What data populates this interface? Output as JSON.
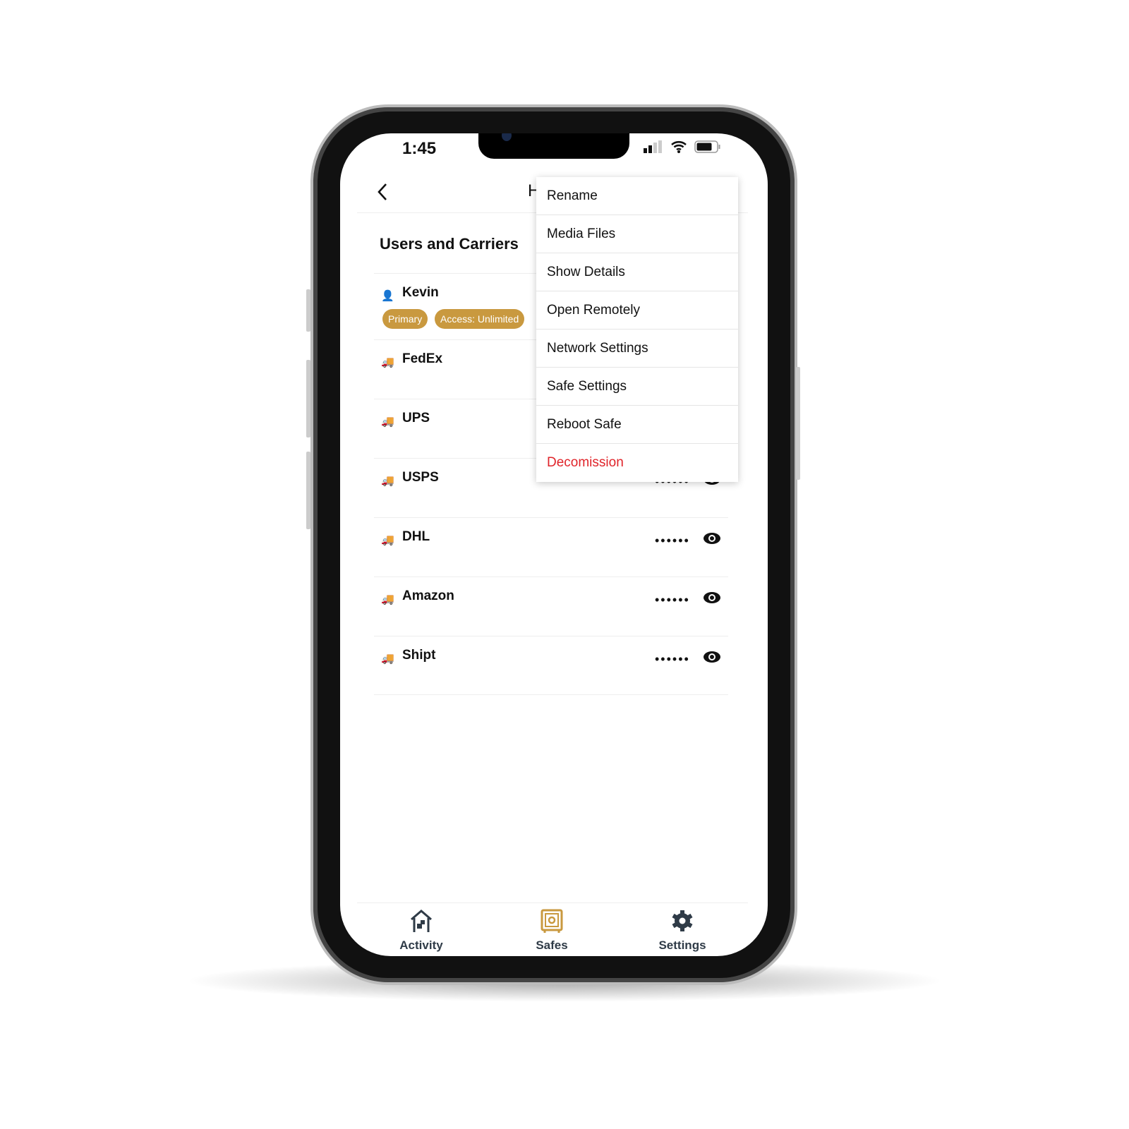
{
  "status_bar": {
    "time": "1:45"
  },
  "header": {
    "title": "H",
    "back_icon": "chevron-left-icon"
  },
  "section_title": "Users and Carriers",
  "user": {
    "name": "Kevin",
    "badges": [
      "Primary",
      "Access: Unlimited"
    ]
  },
  "carriers": [
    {
      "name": "FedEx",
      "code": "••••••"
    },
    {
      "name": "UPS",
      "code": "••••••"
    },
    {
      "name": "USPS",
      "code": "••••••"
    },
    {
      "name": "DHL",
      "code": "••••••"
    },
    {
      "name": "Amazon",
      "code": "••••••"
    },
    {
      "name": "Shipt",
      "code": "••••••"
    }
  ],
  "menu": [
    "Rename",
    "Media Files",
    "Show Details",
    "Open Remotely",
    "Network Settings",
    "Safe Settings",
    "Reboot Safe",
    "Decomission"
  ],
  "tabs": [
    {
      "label": "Activity",
      "active": false
    },
    {
      "label": "Safes",
      "active": true
    },
    {
      "label": "Settings",
      "active": false
    }
  ],
  "colors": {
    "accent": "#c9993f",
    "danger": "#e0242a",
    "tab_icon": "#2f3b47"
  }
}
